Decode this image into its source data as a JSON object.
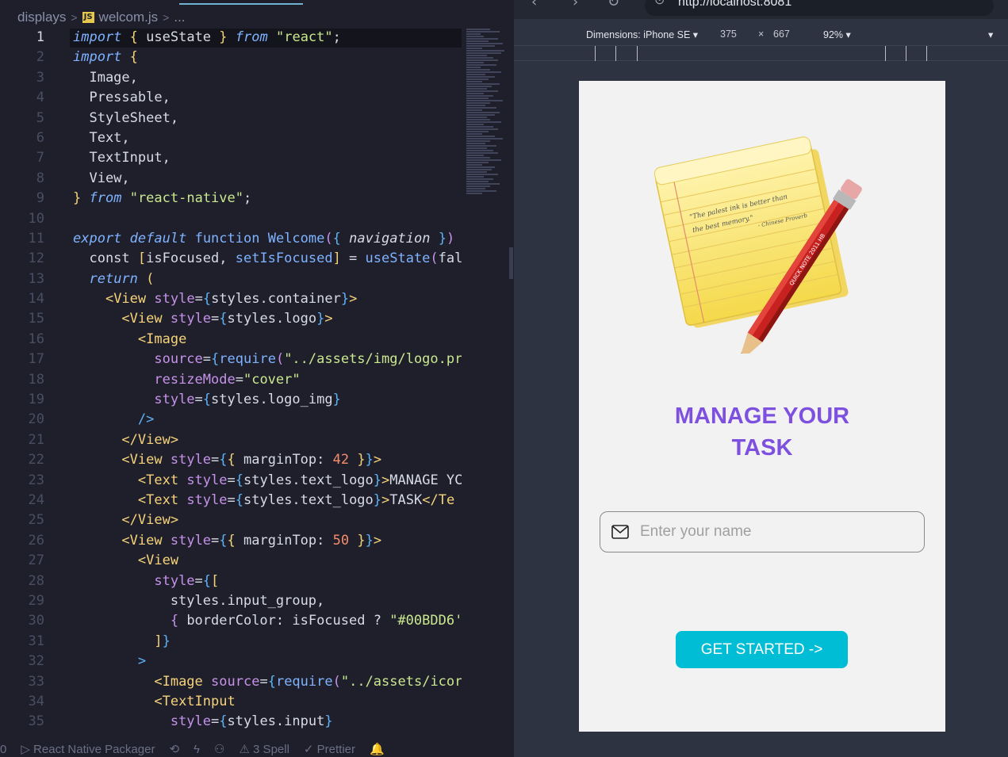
{
  "editor": {
    "breadcrumb": [
      "displays",
      "welcom.js",
      "..."
    ],
    "file_badge": "JS",
    "active_line": 1,
    "lines": [
      [
        [
          "kw",
          "import"
        ],
        [
          "id",
          " "
        ],
        [
          "br",
          "{"
        ],
        [
          "id",
          " useState "
        ],
        [
          "br",
          "}"
        ],
        [
          "id",
          " "
        ],
        [
          "kw",
          "from"
        ],
        [
          "id",
          " "
        ],
        [
          "str",
          "\"react\""
        ],
        [
          "id",
          ";"
        ]
      ],
      [
        [
          "kw",
          "import"
        ],
        [
          "id",
          " "
        ],
        [
          "br",
          "{"
        ]
      ],
      [
        [
          "id",
          "  Image,"
        ]
      ],
      [
        [
          "id",
          "  Pressable,"
        ]
      ],
      [
        [
          "id",
          "  StyleSheet,"
        ]
      ],
      [
        [
          "id",
          "  Text,"
        ]
      ],
      [
        [
          "id",
          "  TextInput,"
        ]
      ],
      [
        [
          "id",
          "  View,"
        ]
      ],
      [
        [
          "br",
          "}"
        ],
        [
          "id",
          " "
        ],
        [
          "kw",
          "from"
        ],
        [
          "id",
          " "
        ],
        [
          "str",
          "\"react-native\""
        ],
        [
          "id",
          ";"
        ]
      ],
      [],
      [
        [
          "kw",
          "export"
        ],
        [
          "id",
          " "
        ],
        [
          "kw",
          "default"
        ],
        [
          "id",
          " "
        ],
        [
          "fn",
          "function"
        ],
        [
          "id",
          " "
        ],
        [
          "fn",
          "Welcome"
        ],
        [
          "br2",
          "("
        ],
        [
          "br3",
          "{"
        ],
        [
          "pl",
          " navigation "
        ],
        [
          "br3",
          "}"
        ],
        [
          "br2",
          ")"
        ]
      ],
      [
        [
          "id",
          "  const "
        ],
        [
          "br",
          "["
        ],
        [
          "id",
          "isFocused, "
        ],
        [
          "fn",
          "setIsFocused"
        ],
        [
          "br",
          "]"
        ],
        [
          "id",
          " = "
        ],
        [
          "fn",
          "useState"
        ],
        [
          "br2",
          "("
        ],
        [
          "id",
          "fal"
        ]
      ],
      [
        [
          "id",
          "  "
        ],
        [
          "kw",
          "return"
        ],
        [
          "id",
          " "
        ],
        [
          "br",
          "("
        ]
      ],
      [
        [
          "id",
          "    "
        ],
        [
          "tag",
          "<View"
        ],
        [
          "id",
          " "
        ],
        [
          "attr",
          "style"
        ],
        [
          "id",
          "="
        ],
        [
          "br3",
          "{"
        ],
        [
          "id",
          "styles.container"
        ],
        [
          "br3",
          "}"
        ],
        [
          "tag",
          ">"
        ]
      ],
      [
        [
          "id",
          "      "
        ],
        [
          "tag",
          "<View"
        ],
        [
          "id",
          " "
        ],
        [
          "attr",
          "style"
        ],
        [
          "id",
          "="
        ],
        [
          "br3",
          "{"
        ],
        [
          "id",
          "styles.logo"
        ],
        [
          "br3",
          "}"
        ],
        [
          "tag",
          ">"
        ]
      ],
      [
        [
          "id",
          "        "
        ],
        [
          "tag",
          "<Image"
        ]
      ],
      [
        [
          "id",
          "          "
        ],
        [
          "attr",
          "source"
        ],
        [
          "id",
          "="
        ],
        [
          "br3",
          "{"
        ],
        [
          "fn",
          "require"
        ],
        [
          "br2",
          "("
        ],
        [
          "str",
          "\"../assets/img/logo.pr"
        ]
      ],
      [
        [
          "id",
          "          "
        ],
        [
          "attr",
          "resizeMode"
        ],
        [
          "id",
          "="
        ],
        [
          "str",
          "\"cover\""
        ]
      ],
      [
        [
          "id",
          "          "
        ],
        [
          "attr",
          "style"
        ],
        [
          "id",
          "="
        ],
        [
          "br3",
          "{"
        ],
        [
          "id",
          "styles.logo_img"
        ],
        [
          "br3",
          "}"
        ]
      ],
      [
        [
          "id",
          "        "
        ],
        [
          "br3",
          "/>"
        ]
      ],
      [
        [
          "id",
          "      "
        ],
        [
          "tag",
          "</View>"
        ]
      ],
      [
        [
          "id",
          "      "
        ],
        [
          "tag",
          "<View"
        ],
        [
          "id",
          " "
        ],
        [
          "attr",
          "style"
        ],
        [
          "id",
          "="
        ],
        [
          "br3",
          "{"
        ],
        [
          "br",
          "{"
        ],
        [
          "id",
          " marginTop: "
        ],
        [
          "num",
          "42"
        ],
        [
          "id",
          " "
        ],
        [
          "br",
          "}"
        ],
        [
          "br3",
          "}"
        ],
        [
          "tag",
          ">"
        ]
      ],
      [
        [
          "id",
          "        "
        ],
        [
          "tag",
          "<Text"
        ],
        [
          "id",
          " "
        ],
        [
          "attr",
          "style"
        ],
        [
          "id",
          "="
        ],
        [
          "br3",
          "{"
        ],
        [
          "id",
          "styles.text_logo"
        ],
        [
          "br3",
          "}"
        ],
        [
          "tag",
          ">"
        ],
        [
          "id",
          "MANAGE YC"
        ]
      ],
      [
        [
          "id",
          "        "
        ],
        [
          "tag",
          "<Text"
        ],
        [
          "id",
          " "
        ],
        [
          "attr",
          "style"
        ],
        [
          "id",
          "="
        ],
        [
          "br3",
          "{"
        ],
        [
          "id",
          "styles.text_logo"
        ],
        [
          "br3",
          "}"
        ],
        [
          "tag",
          ">"
        ],
        [
          "id",
          "TASK"
        ],
        [
          "tag",
          "</Te"
        ]
      ],
      [
        [
          "id",
          "      "
        ],
        [
          "tag",
          "</View>"
        ]
      ],
      [
        [
          "id",
          "      "
        ],
        [
          "tag",
          "<View"
        ],
        [
          "id",
          " "
        ],
        [
          "attr",
          "style"
        ],
        [
          "id",
          "="
        ],
        [
          "br3",
          "{"
        ],
        [
          "br",
          "{"
        ],
        [
          "id",
          " marginTop: "
        ],
        [
          "num",
          "50"
        ],
        [
          "id",
          " "
        ],
        [
          "br",
          "}"
        ],
        [
          "br3",
          "}"
        ],
        [
          "tag",
          ">"
        ]
      ],
      [
        [
          "id",
          "        "
        ],
        [
          "tag",
          "<View"
        ]
      ],
      [
        [
          "id",
          "          "
        ],
        [
          "attr",
          "style"
        ],
        [
          "id",
          "="
        ],
        [
          "br3",
          "{"
        ],
        [
          "br",
          "["
        ]
      ],
      [
        [
          "id",
          "            styles.input_group,"
        ]
      ],
      [
        [
          "id",
          "            "
        ],
        [
          "br2",
          "{"
        ],
        [
          "id",
          " borderColor: isFocused ? "
        ],
        [
          "str",
          "\"#00BDD6'"
        ]
      ],
      [
        [
          "id",
          "          "
        ],
        [
          "br",
          "]"
        ],
        [
          "br3",
          "}"
        ]
      ],
      [
        [
          "id",
          "        "
        ],
        [
          "br3",
          ">"
        ]
      ],
      [
        [
          "id",
          "          "
        ],
        [
          "tag",
          "<Image"
        ],
        [
          "id",
          " "
        ],
        [
          "attr",
          "source"
        ],
        [
          "id",
          "="
        ],
        [
          "br3",
          "{"
        ],
        [
          "fn",
          "require"
        ],
        [
          "br2",
          "("
        ],
        [
          "str",
          "\"../assets/icor"
        ]
      ],
      [
        [
          "id",
          "          "
        ],
        [
          "tag",
          "<TextInput"
        ]
      ],
      [
        [
          "id",
          "            "
        ],
        [
          "attr",
          "style"
        ],
        [
          "id",
          "="
        ],
        [
          "br3",
          "{"
        ],
        [
          "id",
          "styles.input"
        ],
        [
          "br3",
          "}"
        ]
      ]
    ]
  },
  "statusbar": {
    "items": [
      "0",
      "▷ React Native Packager",
      "⟲",
      "ϟ",
      "⚇",
      "⚠ 3 Spell",
      "✓ Prettier",
      "🔔"
    ]
  },
  "browser": {
    "url": "http://localhost:8081",
    "dimensions_label": "Dimensions: iPhone SE ▾",
    "width": "375",
    "times": "×",
    "height": "667",
    "zoom": "92% ▾",
    "more": "▾"
  },
  "app": {
    "logo_quote": "\"The palest ink is better than the best memory.\"",
    "logo_attribution": "- Chinese Proverb",
    "pencil_text": "QUICK NOTE 2011 HB",
    "title_line1": "MANAGE YOUR",
    "title_line2": "TASK",
    "input_placeholder": "Enter your name",
    "button_label": "GET STARTED ->",
    "accent_color": "#00bdd6",
    "title_color": "#7e50e0"
  }
}
